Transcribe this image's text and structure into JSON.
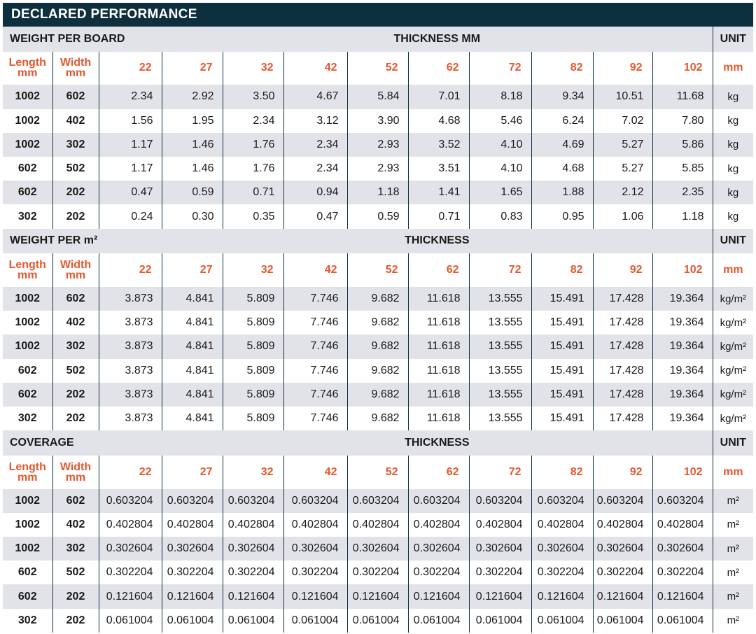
{
  "title": "DECLARED PERFORMANCE",
  "columns": {
    "length_label": "Length",
    "width_label": "Width",
    "dim_unit": "mm",
    "thicknesses": [
      "22",
      "27",
      "32",
      "42",
      "52",
      "62",
      "72",
      "82",
      "92",
      "102"
    ],
    "unit_header_value": "mm"
  },
  "sections": [
    {
      "title": "WEIGHT PER BOARD",
      "subheader": "THICKNESS MM",
      "unit_header": "UNIT",
      "rows": [
        {
          "length": "1002",
          "width": "602",
          "values": [
            "2.34",
            "2.92",
            "3.50",
            "4.67",
            "5.84",
            "7.01",
            "8.18",
            "9.34",
            "10.51",
            "11.68"
          ],
          "unit": "kg"
        },
        {
          "length": "1002",
          "width": "402",
          "values": [
            "1.56",
            "1.95",
            "2.34",
            "3.12",
            "3.90",
            "4.68",
            "5.46",
            "6.24",
            "7.02",
            "7.80"
          ],
          "unit": "kg"
        },
        {
          "length": "1002",
          "width": "302",
          "values": [
            "1.17",
            "1.46",
            "1.76",
            "2.34",
            "2.93",
            "3.52",
            "4.10",
            "4.69",
            "5.27",
            "5.86"
          ],
          "unit": "kg"
        },
        {
          "length": "602",
          "width": "502",
          "values": [
            "1.17",
            "1.46",
            "1.76",
            "2.34",
            "2.93",
            "3.51",
            "4.10",
            "4.68",
            "5.27",
            "5.85"
          ],
          "unit": "kg"
        },
        {
          "length": "602",
          "width": "202",
          "values": [
            "0.47",
            "0.59",
            "0.71",
            "0.94",
            "1.18",
            "1.41",
            "1.65",
            "1.88",
            "2.12",
            "2.35"
          ],
          "unit": "kg"
        },
        {
          "length": "302",
          "width": "202",
          "values": [
            "0.24",
            "0.30",
            "0.35",
            "0.47",
            "0.59",
            "0.71",
            "0.83",
            "0.95",
            "1.06",
            "1.18"
          ],
          "unit": "kg"
        }
      ]
    },
    {
      "title": "WEIGHT PER m²",
      "subheader": "THICKNESS",
      "unit_header": "UNIT",
      "rows": [
        {
          "length": "1002",
          "width": "602",
          "values": [
            "3.873",
            "4.841",
            "5.809",
            "7.746",
            "9.682",
            "11.618",
            "13.555",
            "15.491",
            "17.428",
            "19.364"
          ],
          "unit": "kg/m²"
        },
        {
          "length": "1002",
          "width": "402",
          "values": [
            "3.873",
            "4.841",
            "5.809",
            "7.746",
            "9.682",
            "11.618",
            "13.555",
            "15.491",
            "17.428",
            "19.364"
          ],
          "unit": "kg/m²"
        },
        {
          "length": "1002",
          "width": "302",
          "values": [
            "3.873",
            "4.841",
            "5.809",
            "7.746",
            "9.682",
            "11.618",
            "13.555",
            "15.491",
            "17.428",
            "19.364"
          ],
          "unit": "kg/m²"
        },
        {
          "length": "602",
          "width": "502",
          "values": [
            "3.873",
            "4.841",
            "5.809",
            "7.746",
            "9.682",
            "11.618",
            "13.555",
            "15.491",
            "17.428",
            "19.364"
          ],
          "unit": "kg/m²"
        },
        {
          "length": "602",
          "width": "202",
          "values": [
            "3.873",
            "4.841",
            "5.809",
            "7.746",
            "9.682",
            "11.618",
            "13.555",
            "15.491",
            "17.428",
            "19.364"
          ],
          "unit": "kg/m²"
        },
        {
          "length": "302",
          "width": "202",
          "values": [
            "3.873",
            "4.841",
            "5.809",
            "7.746",
            "9.682",
            "11.618",
            "13.555",
            "15.491",
            "17.428",
            "19.364"
          ],
          "unit": "kg/m²"
        }
      ]
    },
    {
      "title": "COVERAGE",
      "subheader": "THICKNESS",
      "unit_header": "UNIT",
      "rows": [
        {
          "length": "1002",
          "width": "602",
          "values": [
            "0.603204",
            "0.603204",
            "0.603204",
            "0.603204",
            "0.603204",
            "0.603204",
            "0.603204",
            "0.603204",
            "0.603204",
            "0.603204"
          ],
          "unit": "m²"
        },
        {
          "length": "1002",
          "width": "402",
          "values": [
            "0.402804",
            "0.402804",
            "0.402804",
            "0.402804",
            "0.402804",
            "0.402804",
            "0.402804",
            "0.402804",
            "0.402804",
            "0.402804"
          ],
          "unit": "m²"
        },
        {
          "length": "1002",
          "width": "302",
          "values": [
            "0.302604",
            "0.302604",
            "0.302604",
            "0.302604",
            "0.302604",
            "0.302604",
            "0.302604",
            "0.302604",
            "0.302604",
            "0.302604"
          ],
          "unit": "m²"
        },
        {
          "length": "602",
          "width": "502",
          "values": [
            "0.302204",
            "0.302204",
            "0.302204",
            "0.302204",
            "0.302204",
            "0.302204",
            "0.302204",
            "0.302204",
            "0.302204",
            "0.302204"
          ],
          "unit": "m²"
        },
        {
          "length": "602",
          "width": "202",
          "values": [
            "0.121604",
            "0.121604",
            "0.121604",
            "0.121604",
            "0.121604",
            "0.121604",
            "0.121604",
            "0.121604",
            "0.121604",
            "0.121604"
          ],
          "unit": "m²"
        },
        {
          "length": "302",
          "width": "202",
          "values": [
            "0.061004",
            "0.061004",
            "0.061004",
            "0.061004",
            "0.061004",
            "0.061004",
            "0.061004",
            "0.061004",
            "0.061004",
            "0.061004"
          ],
          "unit": "m²"
        }
      ]
    }
  ],
  "colors": {
    "title_bar": "#0e2f3e",
    "section_band": "#e2e3e8",
    "header_accent": "#e4572e",
    "rule": "#0e2f3e"
  }
}
